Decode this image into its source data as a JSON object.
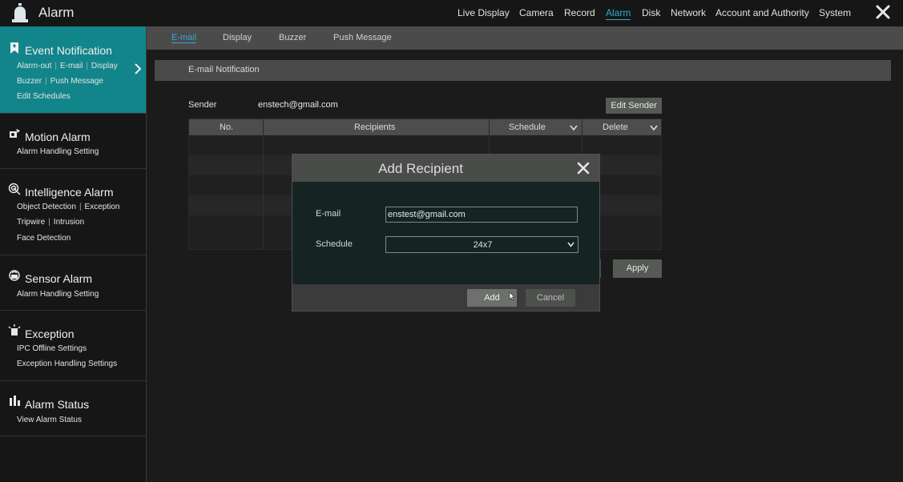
{
  "app": {
    "title": "Alarm",
    "icon": "alarm-bell-icon"
  },
  "topnav": {
    "items": [
      "Live Display",
      "Camera",
      "Record",
      "Alarm",
      "Disk",
      "Network",
      "Account and Authority",
      "System"
    ],
    "active": "Alarm",
    "close_icon": "close-icon"
  },
  "sidebar": {
    "sections": [
      {
        "title": "Event Notification",
        "icon": "bookmark-icon",
        "active": true,
        "sub_lines": [
          [
            "Alarm-out",
            "E-mail",
            "Display"
          ],
          [
            "Buzzer",
            "Push Message"
          ],
          [
            "Edit Schedules"
          ]
        ]
      },
      {
        "title": "Motion Alarm",
        "icon": "motion-icon",
        "sub_lines": [
          [
            "Alarm Handling Setting"
          ]
        ]
      },
      {
        "title": "Intelligence Alarm",
        "icon": "radar-icon",
        "sub_lines": [
          [
            "Object Detection",
            "Exception"
          ],
          [
            "Tripwire",
            "Intrusion"
          ],
          [
            "Face Detection"
          ]
        ]
      },
      {
        "title": "Sensor Alarm",
        "icon": "sensor-icon",
        "sub_lines": [
          [
            "Alarm Handling Setting"
          ]
        ]
      },
      {
        "title": "Exception",
        "icon": "siren-icon",
        "sub_lines": [
          [
            "IPC Offline Settings"
          ],
          [
            "Exception Handling Settings"
          ]
        ]
      },
      {
        "title": "Alarm Status",
        "icon": "bar-chart-icon",
        "sub_lines": [
          [
            "View Alarm Status"
          ]
        ]
      }
    ]
  },
  "tabs": {
    "items": [
      "E-mail",
      "Display",
      "Buzzer",
      "Push Message"
    ],
    "active": "E-mail"
  },
  "section": {
    "title": "E-mail Notification"
  },
  "sender": {
    "label": "Sender",
    "value": "enstech@gmail.com",
    "edit_label": "Edit Sender"
  },
  "table": {
    "headers": [
      "No.",
      "Recipients",
      "Schedule",
      "Delete"
    ]
  },
  "apply_label": "Apply",
  "dialog": {
    "title": "Add Recipient",
    "email_label": "E-mail",
    "email_value": "enstest@gmail.com",
    "schedule_label": "Schedule",
    "schedule_value": "24x7",
    "add_label": "Add",
    "cancel_label": "Cancel"
  },
  "colors": {
    "accent": "#12858a",
    "link": "#3aa6d6"
  }
}
